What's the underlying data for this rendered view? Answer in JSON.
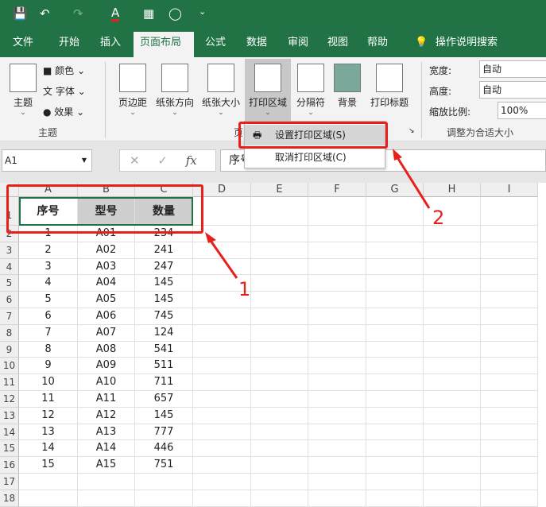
{
  "qat": {
    "save": "💾",
    "undo": "↶",
    "redo": "↷",
    "font_color": "A",
    "circle": "◯",
    "more": "⌄"
  },
  "tabs": [
    "文件",
    "开始",
    "插入",
    "页面布局",
    "公式",
    "数据",
    "审阅",
    "视图",
    "帮助"
  ],
  "search": {
    "icon": "💡",
    "label": "操作说明搜索"
  },
  "ribbon": {
    "theme": {
      "label": "主题",
      "colors": "颜色",
      "fonts": "字体",
      "effects": "效果",
      "group": "主题"
    },
    "page_setup": {
      "margins": "页边距",
      "orientation": "纸张方向",
      "size": "纸张大小",
      "print_area": "打印区域",
      "breaks": "分隔符",
      "background": "背景",
      "print_titles": "打印标题",
      "group": "页"
    },
    "scale": {
      "width_label": "宽度:",
      "width_value": "自动",
      "height_label": "高度:",
      "height_value": "自动",
      "scale_label": "缩放比例:",
      "scale_value": "100%",
      "group": "调整为合适大小"
    }
  },
  "menu": {
    "set": "设置打印区域(S)",
    "clear": "取消打印区域(C)"
  },
  "formula_bar": {
    "name_box": "A1",
    "cancel": "✕",
    "enter": "✓",
    "fx": "fx",
    "content": "序号"
  },
  "columns": [
    "A",
    "B",
    "C",
    "D",
    "E",
    "F",
    "G",
    "H",
    "I"
  ],
  "headers": [
    "序号",
    "型号",
    "数量"
  ],
  "rows": [
    [
      "1",
      "A01",
      "234"
    ],
    [
      "2",
      "A02",
      "241"
    ],
    [
      "3",
      "A03",
      "247"
    ],
    [
      "4",
      "A04",
      "145"
    ],
    [
      "5",
      "A05",
      "145"
    ],
    [
      "6",
      "A06",
      "745"
    ],
    [
      "7",
      "A07",
      "124"
    ],
    [
      "8",
      "A08",
      "541"
    ],
    [
      "9",
      "A09",
      "511"
    ],
    [
      "10",
      "A10",
      "711"
    ],
    [
      "11",
      "A11",
      "657"
    ],
    [
      "12",
      "A12",
      "145"
    ],
    [
      "13",
      "A13",
      "777"
    ],
    [
      "14",
      "A14",
      "446"
    ],
    [
      "15",
      "A15",
      "751"
    ]
  ],
  "annotations": [
    "1",
    "2"
  ]
}
